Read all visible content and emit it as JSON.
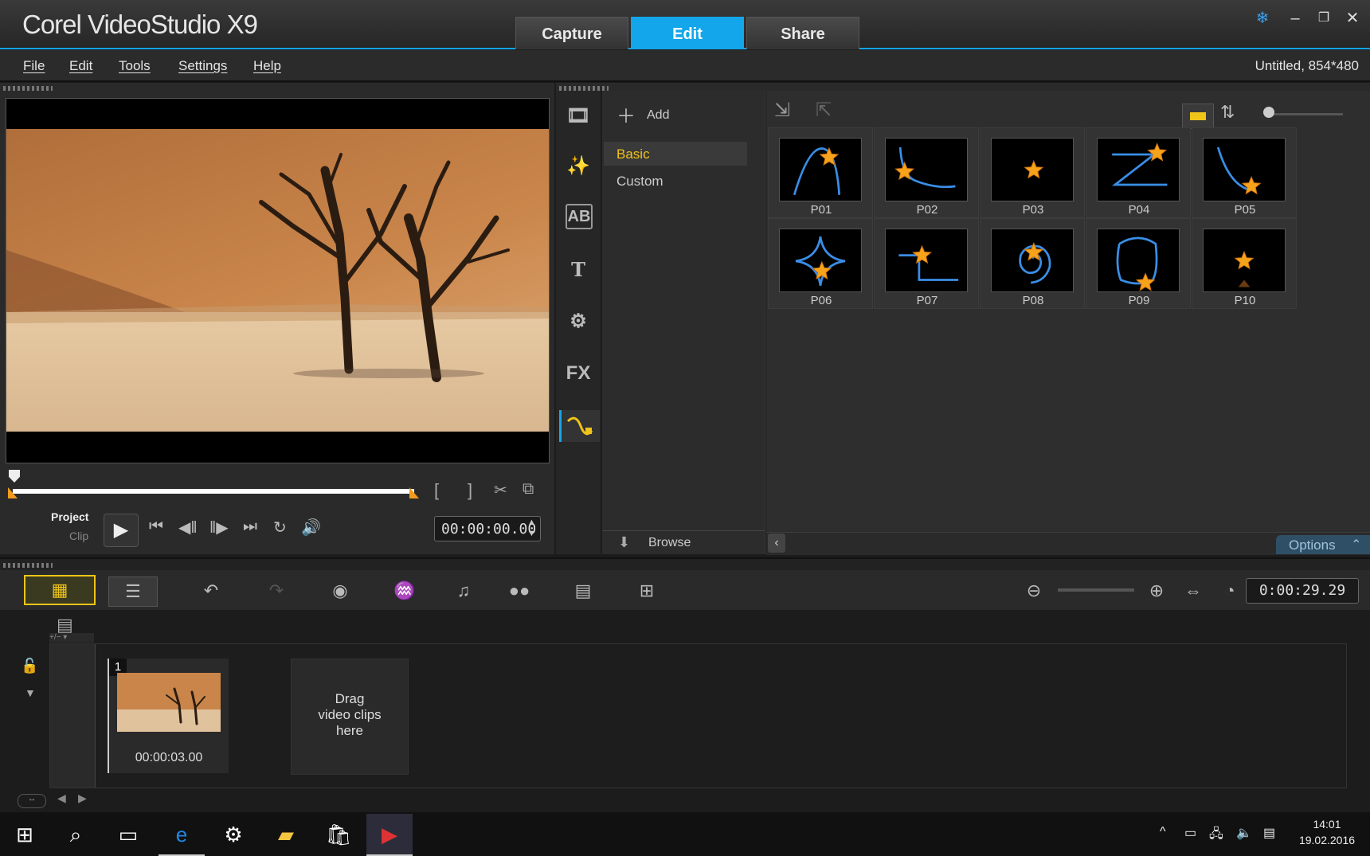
{
  "app": {
    "title": "Corel VideoStudio X9"
  },
  "top_tabs": [
    {
      "label": "Capture"
    },
    {
      "label": "Edit"
    },
    {
      "label": "Share"
    }
  ],
  "menu": [
    {
      "label": "File"
    },
    {
      "label": "Edit"
    },
    {
      "label": "Tools"
    },
    {
      "label": "Settings"
    },
    {
      "label": "Help"
    }
  ],
  "project_info": "Untitled, 854*480",
  "player": {
    "mode_project": "Project",
    "mode_clip": "Clip",
    "timecode": "00:00:00.00",
    "bracket_in": "[",
    "bracket_out": "]"
  },
  "library": {
    "add_label": "Add",
    "categories": [
      {
        "label": "Basic"
      },
      {
        "label": "Custom"
      }
    ],
    "browse_label": "Browse",
    "options_label": "Options",
    "items": [
      {
        "label": "P01"
      },
      {
        "label": "P02"
      },
      {
        "label": "P03"
      },
      {
        "label": "P04"
      },
      {
        "label": "P05"
      },
      {
        "label": "P06"
      },
      {
        "label": "P07"
      },
      {
        "label": "P08"
      },
      {
        "label": "P09"
      },
      {
        "label": "P10"
      }
    ],
    "side_icons": [
      {
        "name": "media-icon"
      },
      {
        "name": "instant-project-icon"
      },
      {
        "name": "transition-icon",
        "text": "AB"
      },
      {
        "name": "title-icon",
        "text": "T"
      },
      {
        "name": "graphic-icon"
      },
      {
        "name": "filter-icon",
        "text": "FX"
      },
      {
        "name": "path-icon"
      }
    ]
  },
  "timeline": {
    "total_time": "0:00:29.29",
    "clip_number": "1",
    "clip_duration": "00:00:03.00",
    "drop_hint_1": "Drag",
    "drop_hint_2": "video clips",
    "drop_hint_3": "here"
  },
  "taskbar": {
    "time": "14:01",
    "date": "19.02.2016"
  },
  "colors": {
    "accent": "#14a6ea",
    "highlight_yellow": "#f0c419",
    "star_orange": "#f7a21b",
    "path_blue": "#3a8ee6"
  }
}
